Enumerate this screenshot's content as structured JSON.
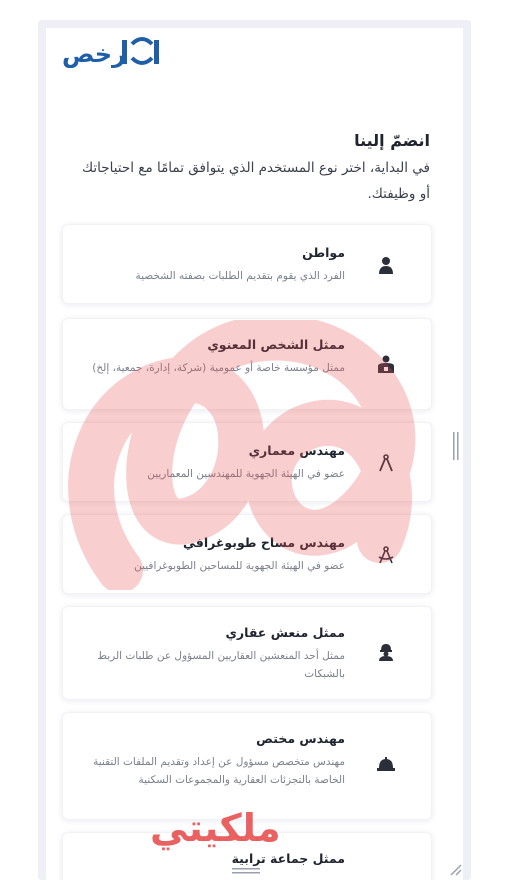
{
  "brand": {
    "logo_text": "رخص"
  },
  "join": {
    "title": "انضمّ إلينا",
    "intro": "في البداية، اختر نوع المستخدم الذي يتوافق تمامًا مع احتياجاتك أو وظيفتك."
  },
  "user_types": [
    {
      "title": "مواطن",
      "desc": "الفرد الذي يقوم بتقديم الطلبات بصفته الشخصية",
      "icon": "person-icon"
    },
    {
      "title": "ممثل الشخص المعنوي",
      "desc": "ممثل مؤسسة خاصة أو عمومية (شركة، إدارة، جمعية، إلخ)",
      "icon": "legal-entity-icon"
    },
    {
      "title": "مهندس معماري",
      "desc": "عضو في الهيئة الجهوية للمهندسين المعماريين",
      "icon": "compass-icon"
    },
    {
      "title": "مهندس مساح طوبوغرافي",
      "desc": "عضو في الهيئة الجهوية للمساحين الطوبوغرافيين",
      "icon": "drafting-compass-icon"
    },
    {
      "title": "ممثل منعش عقاري",
      "desc": "ممثل أحد المنعشين العقاريين المسؤول عن طلبات الربط بالشبكات",
      "icon": "worker-helmet-icon"
    },
    {
      "title": "مهندس مختص",
      "desc": "مهندس متخصص مسؤول عن إعداد وتقديم الملفات التقنية الخاصة بالتجزئات العقارية والمجموعات السكنية",
      "icon": "hard-hat-icon"
    },
    {
      "title": "ممثل جماعة ترابية",
      "desc": "",
      "icon": "building-icon"
    }
  ],
  "watermark": {
    "text": "ملكيتي"
  },
  "colors": {
    "brand": "#1f5fa8",
    "watermark": "#e85050"
  }
}
